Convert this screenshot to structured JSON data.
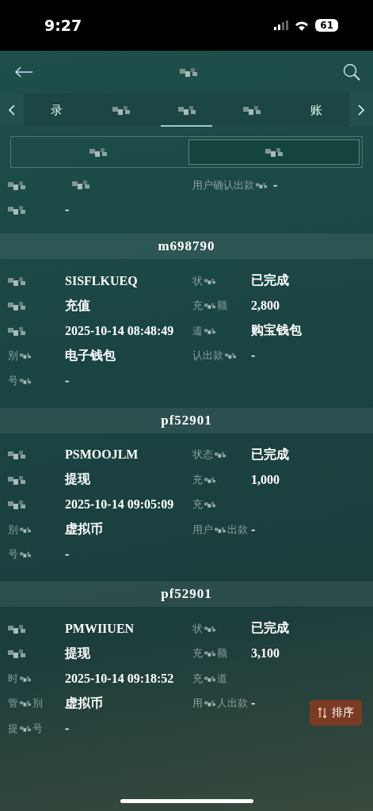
{
  "status_bar": {
    "time": "9:27",
    "battery": "61"
  },
  "tab_strip": {
    "tabs": [
      {
        "label": "录",
        "selected": false
      },
      {
        "selected": false
      },
      {
        "selected": true
      },
      {
        "selected": false
      },
      {
        "label": "账",
        "selected": false
      }
    ]
  },
  "segments": [
    {
      "selected": false
    },
    {
      "selected": true
    }
  ],
  "partial_card": {
    "rows": [
      {
        "left": {},
        "right": {
          "label": [
            "用户确认出款"
          ],
          "value": "-"
        }
      },
      {
        "left": {
          "value": "-"
        }
      }
    ]
  },
  "cards": [
    {
      "title": "m698790",
      "rows": [
        {
          "left": {
            "value": "SISFLKUEQ"
          },
          "right": {
            "label": [
              "状"
            ],
            "value": "已完成"
          }
        },
        {
          "left": {
            "value": "充值"
          },
          "right": {
            "label": [
              "充",
              "额"
            ],
            "value": "2,800"
          }
        },
        {
          "left": {
            "value": "2025-10-14 08:48:49"
          },
          "right": {
            "label": [
              "道"
            ],
            "value": "购宝钱包"
          }
        },
        {
          "left": {
            "label": [
              "别"
            ],
            "value": "电子钱包"
          },
          "right": {
            "label": [
              "认出款"
            ],
            "value": "-"
          }
        },
        {
          "left": {
            "label": [
              "号"
            ],
            "value": "-"
          }
        }
      ]
    },
    {
      "title": "pf52901",
      "rows": [
        {
          "left": {
            "value": "PSMOOJLM"
          },
          "right": {
            "label": [
              "状态"
            ],
            "value": "已完成"
          }
        },
        {
          "left": {
            "value": "提现"
          },
          "right": {
            "label": [
              "充"
            ],
            "value": "1,000"
          }
        },
        {
          "left": {
            "value": "2025-10-14 09:05:09"
          },
          "right": {
            "label": [
              "充"
            ]
          }
        },
        {
          "left": {
            "label": [
              "别"
            ],
            "value": "虚拟币"
          },
          "right": {
            "label": [
              "用户",
              "出款"
            ],
            "value": "-"
          }
        },
        {
          "left": {
            "label": [
              "号"
            ],
            "value": "-"
          }
        }
      ]
    },
    {
      "title": "pf52901",
      "rows": [
        {
          "left": {
            "value": "PMWIIUEN"
          },
          "right": {
            "label": [
              "状"
            ],
            "value": "已完成"
          }
        },
        {
          "left": {
            "value": "提现"
          },
          "right": {
            "label": [
              "充",
              "额"
            ],
            "value": "3,100"
          }
        },
        {
          "left": {
            "label": [
              "时"
            ],
            "value": "2025-10-14 09:18:52"
          },
          "right": {
            "label": [
              "充",
              "道"
            ]
          }
        },
        {
          "left": {
            "label": [
              "管",
              "别"
            ],
            "value": "虚拟币"
          },
          "right": {
            "label": [
              "用",
              "人出款"
            ],
            "value": "-"
          }
        },
        {
          "left": {
            "label": [
              "提",
              "号"
            ],
            "value": "-"
          }
        }
      ]
    }
  ],
  "sort_button": {
    "label": "排序"
  }
}
